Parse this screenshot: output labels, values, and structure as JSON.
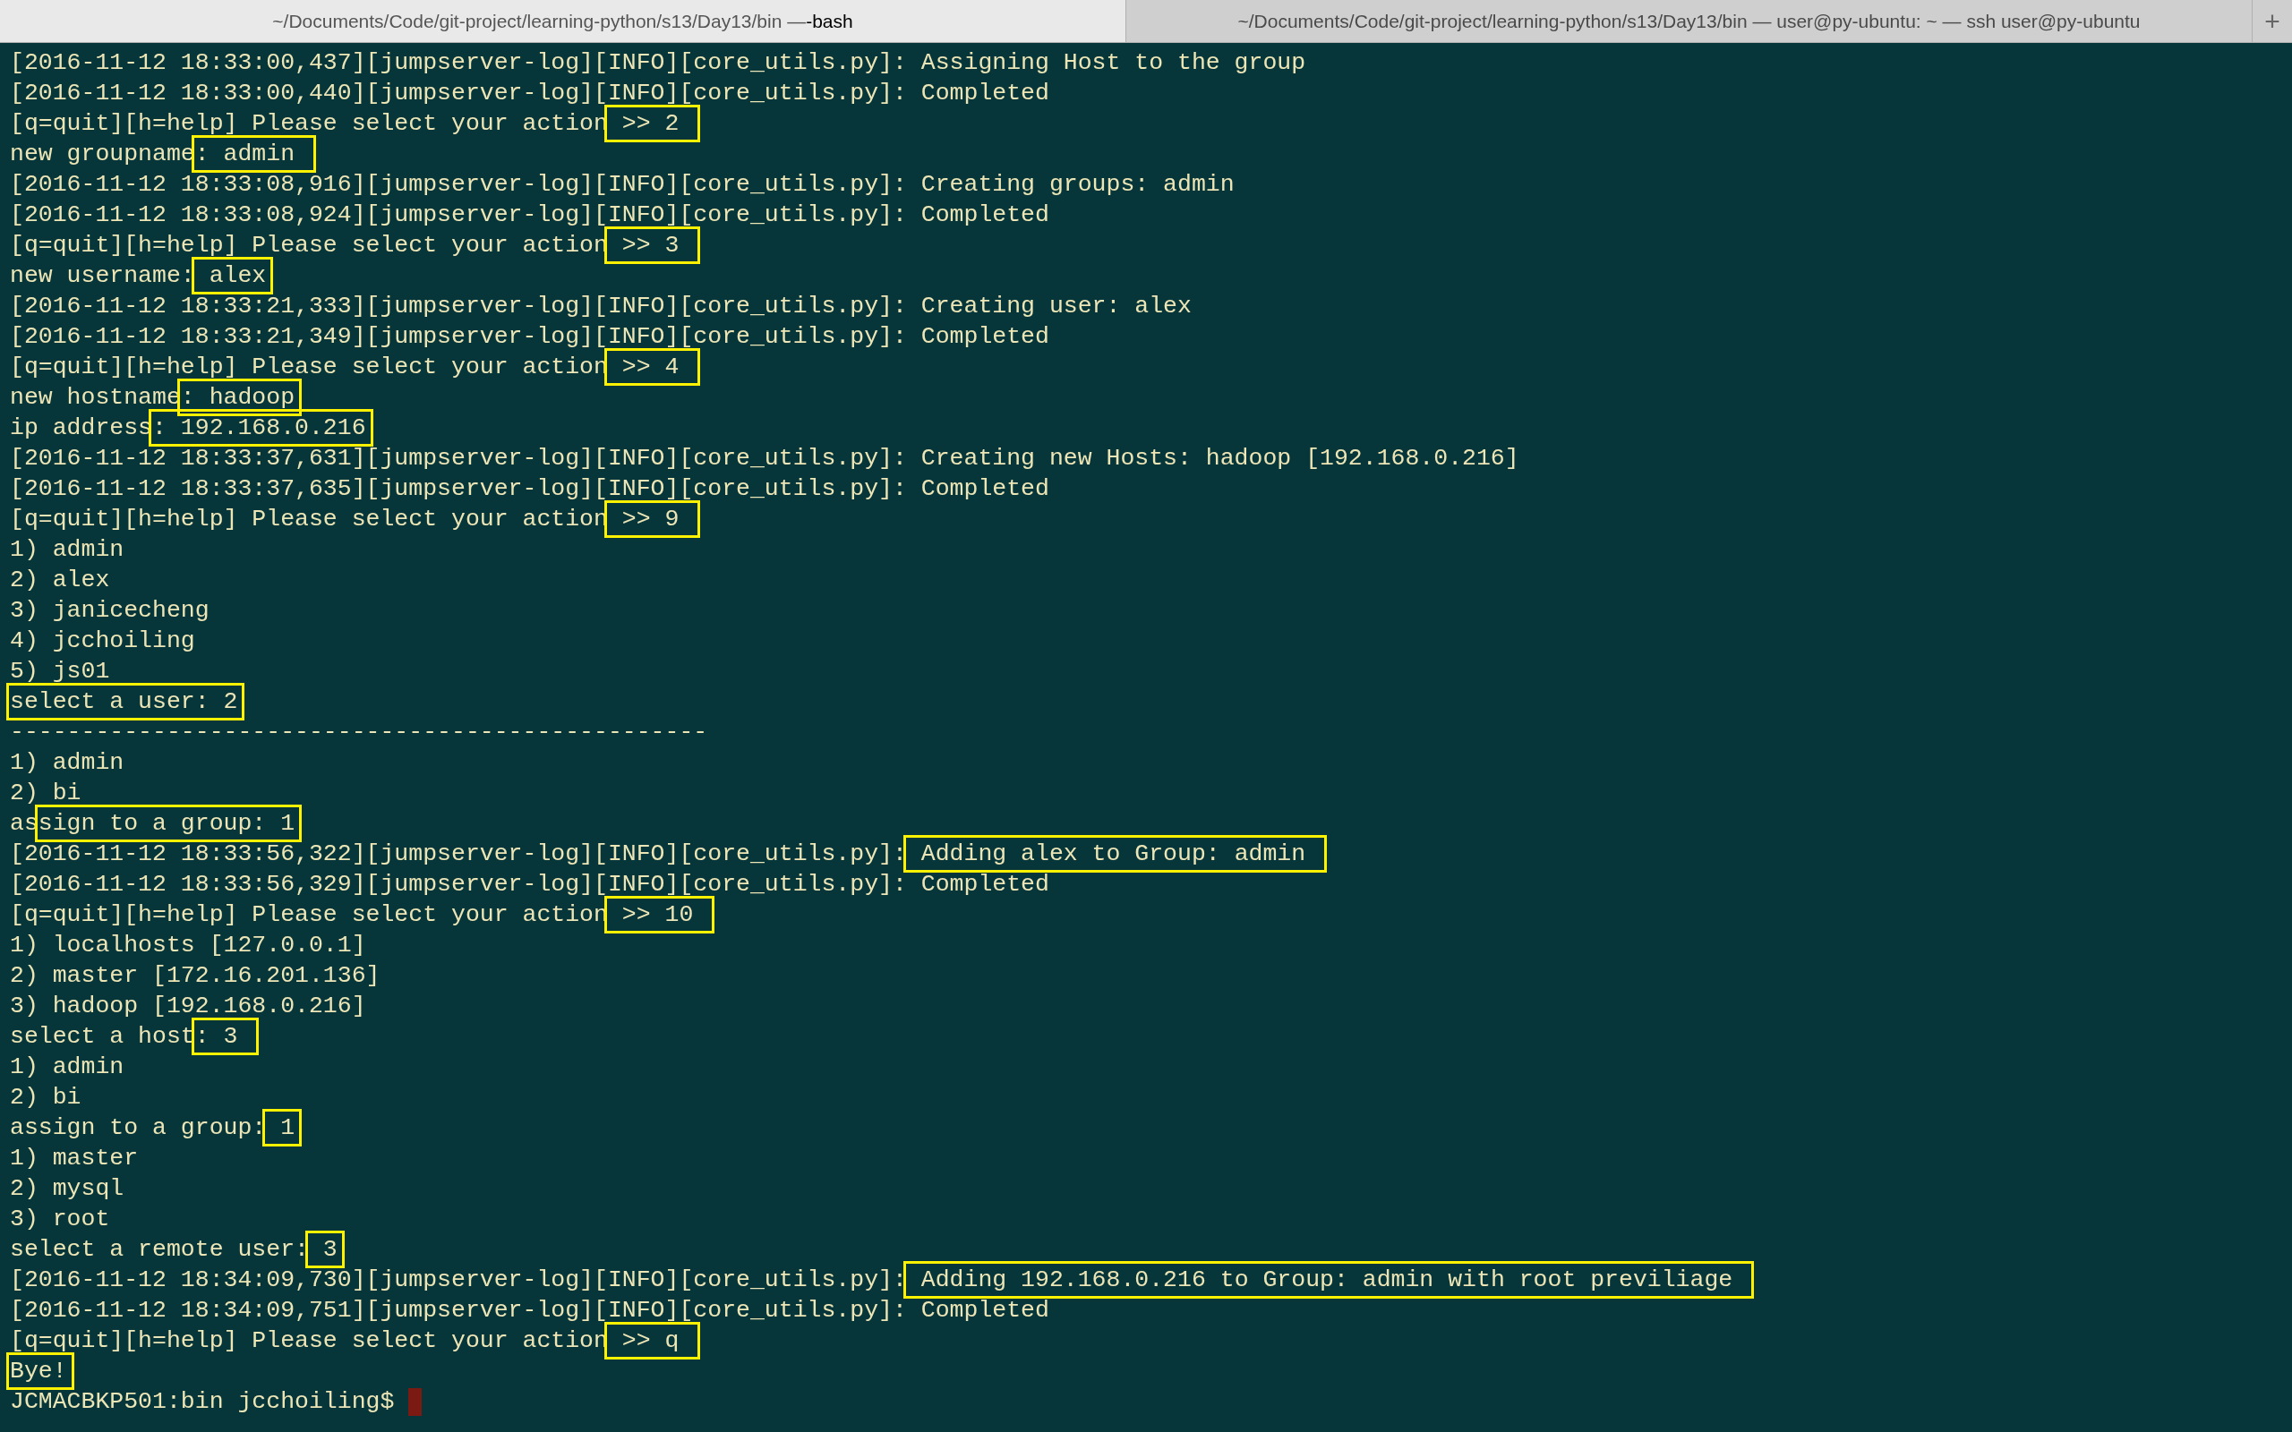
{
  "tabs": [
    {
      "path": "~/Documents/Code/git-project/learning-python/s13/Day13/bin — ",
      "process": "-bash",
      "selected": true
    },
    {
      "path": "~/Documents/Code/git-project/learning-python/s13/Day13/bin — user@py-ubuntu: ~ — ssh user@py-ubuntu",
      "selected": false
    }
  ],
  "new_tab_button": "+",
  "lines": [
    {
      "parts": [
        {
          "text": "[2016-11-12 18:33:00,437][jumpserver-log][INFO][core_utils.py]: Assigning Host to the group",
          "boxed": false
        }
      ]
    },
    {
      "parts": [
        {
          "text": "[2016-11-12 18:33:00,440][jumpserver-log][INFO][core_utils.py]: Completed",
          "boxed": false
        }
      ]
    },
    {
      "parts": [
        {
          "text": "[q=quit][h=help] Please select your action",
          "boxed": false
        },
        {
          "text": " >> 2 ",
          "boxed": true
        }
      ]
    },
    {
      "parts": [
        {
          "text": "new groupname",
          "boxed": false
        },
        {
          "text": ": admin ",
          "boxed": true
        }
      ]
    },
    {
      "parts": [
        {
          "text": "[2016-11-12 18:33:08,916][jumpserver-log][INFO][core_utils.py]: Creating groups: admin",
          "boxed": false
        }
      ]
    },
    {
      "parts": [
        {
          "text": "[2016-11-12 18:33:08,924][jumpserver-log][INFO][core_utils.py]: Completed",
          "boxed": false
        }
      ]
    },
    {
      "parts": [
        {
          "text": "[q=quit][h=help] Please select your action",
          "boxed": false
        },
        {
          "text": " >> 3 ",
          "boxed": true
        }
      ]
    },
    {
      "parts": [
        {
          "text": "new username:",
          "boxed": false
        },
        {
          "text": " alex",
          "boxed": true
        }
      ]
    },
    {
      "parts": [
        {
          "text": "[2016-11-12 18:33:21,333][jumpserver-log][INFO][core_utils.py]: Creating user: alex",
          "boxed": false
        }
      ]
    },
    {
      "parts": [
        {
          "text": "[2016-11-12 18:33:21,349][jumpserver-log][INFO][core_utils.py]: Completed",
          "boxed": false
        }
      ]
    },
    {
      "parts": [
        {
          "text": "[q=quit][h=help] Please select your action",
          "boxed": false
        },
        {
          "text": " >> 4 ",
          "boxed": true
        }
      ]
    },
    {
      "parts": [
        {
          "text": "new hostname",
          "boxed": false
        },
        {
          "text": ": hadoop",
          "boxed": true
        }
      ]
    },
    {
      "parts": [
        {
          "text": "ip address",
          "boxed": false
        },
        {
          "text": ": 192.168.0.216",
          "boxed": true
        }
      ]
    },
    {
      "parts": [
        {
          "text": "[2016-11-12 18:33:37,631][jumpserver-log][INFO][core_utils.py]: Creating new Hosts: hadoop [192.168.0.216]",
          "boxed": false
        }
      ]
    },
    {
      "parts": [
        {
          "text": "[2016-11-12 18:33:37,635][jumpserver-log][INFO][core_utils.py]: Completed",
          "boxed": false
        }
      ]
    },
    {
      "parts": [
        {
          "text": "[q=quit][h=help] Please select your action",
          "boxed": false
        },
        {
          "text": " >> 9 ",
          "boxed": true
        }
      ]
    },
    {
      "parts": [
        {
          "text": "1) admin",
          "boxed": false
        }
      ]
    },
    {
      "parts": [
        {
          "text": "2) alex",
          "boxed": false
        }
      ]
    },
    {
      "parts": [
        {
          "text": "3) janicecheng",
          "boxed": false
        }
      ]
    },
    {
      "parts": [
        {
          "text": "4) jcchoiling",
          "boxed": false
        }
      ]
    },
    {
      "parts": [
        {
          "text": "5) js01",
          "boxed": false
        }
      ]
    },
    {
      "parts": [
        {
          "text": "select a user: 2",
          "boxed": true
        }
      ]
    },
    {
      "parts": [
        {
          "text": "-------------------------------------------------",
          "boxed": false
        }
      ]
    },
    {
      "parts": [
        {
          "text": "1) admin",
          "boxed": false
        }
      ]
    },
    {
      "parts": [
        {
          "text": "2) bi",
          "boxed": false
        }
      ]
    },
    {
      "parts": [
        {
          "text": "as",
          "boxed": false
        },
        {
          "text": "sign to a group: 1",
          "boxed": true
        }
      ]
    },
    {
      "parts": [
        {
          "text": "[2016-11-12 18:33:56,322][jumpserver-log][INFO][core_utils.py]:",
          "boxed": false
        },
        {
          "text": " Adding alex to Group: admin ",
          "boxed": true
        }
      ]
    },
    {
      "parts": [
        {
          "text": "[2016-11-12 18:33:56,329][jumpserver-log][INFO][core_utils.py]: Completed",
          "boxed": false
        }
      ]
    },
    {
      "parts": [
        {
          "text": "[q=quit][h=help] Please select your action",
          "boxed": false
        },
        {
          "text": " >> 10 ",
          "boxed": true
        }
      ]
    },
    {
      "parts": [
        {
          "text": "1) localhosts [127.0.0.1]",
          "boxed": false
        }
      ]
    },
    {
      "parts": [
        {
          "text": "2) master [172.16.201.136]",
          "boxed": false
        }
      ]
    },
    {
      "parts": [
        {
          "text": "3) hadoop [192.168.0.216]",
          "boxed": false
        }
      ]
    },
    {
      "parts": [
        {
          "text": "select a host",
          "boxed": false
        },
        {
          "text": ": 3 ",
          "boxed": true
        }
      ]
    },
    {
      "parts": [
        {
          "text": "1) admin",
          "boxed": false
        }
      ]
    },
    {
      "parts": [
        {
          "text": "2) bi",
          "boxed": false
        }
      ]
    },
    {
      "parts": [
        {
          "text": "assign to a group:",
          "boxed": false
        },
        {
          "text": " 1",
          "boxed": true
        }
      ]
    },
    {
      "parts": [
        {
          "text": "1) master",
          "boxed": false
        }
      ]
    },
    {
      "parts": [
        {
          "text": "2) mysql",
          "boxed": false
        }
      ]
    },
    {
      "parts": [
        {
          "text": "3) root",
          "boxed": false
        }
      ]
    },
    {
      "parts": [
        {
          "text": "select a remote user:",
          "boxed": false
        },
        {
          "text": " 3",
          "boxed": true
        }
      ]
    },
    {
      "parts": [
        {
          "text": "[2016-11-12 18:34:09,730][jumpserver-log][INFO][core_utils.py]:",
          "boxed": false
        },
        {
          "text": " Adding 192.168.0.216 to Group: admin with root previliage ",
          "boxed": true
        }
      ]
    },
    {
      "parts": [
        {
          "text": "[2016-11-12 18:34:09,751][jumpserver-log][INFO][core_utils.py]: Completed",
          "boxed": false
        }
      ]
    },
    {
      "parts": [
        {
          "text": "[q=quit][h=help] Please select your action",
          "boxed": false
        },
        {
          "text": " >> q ",
          "boxed": true
        }
      ]
    },
    {
      "parts": [
        {
          "text": "Bye!",
          "boxed": true
        }
      ]
    },
    {
      "parts": [
        {
          "text": "JCMACBKP501:bin jcchoiling$ ",
          "boxed": false
        }
      ],
      "cursor": true
    }
  ]
}
